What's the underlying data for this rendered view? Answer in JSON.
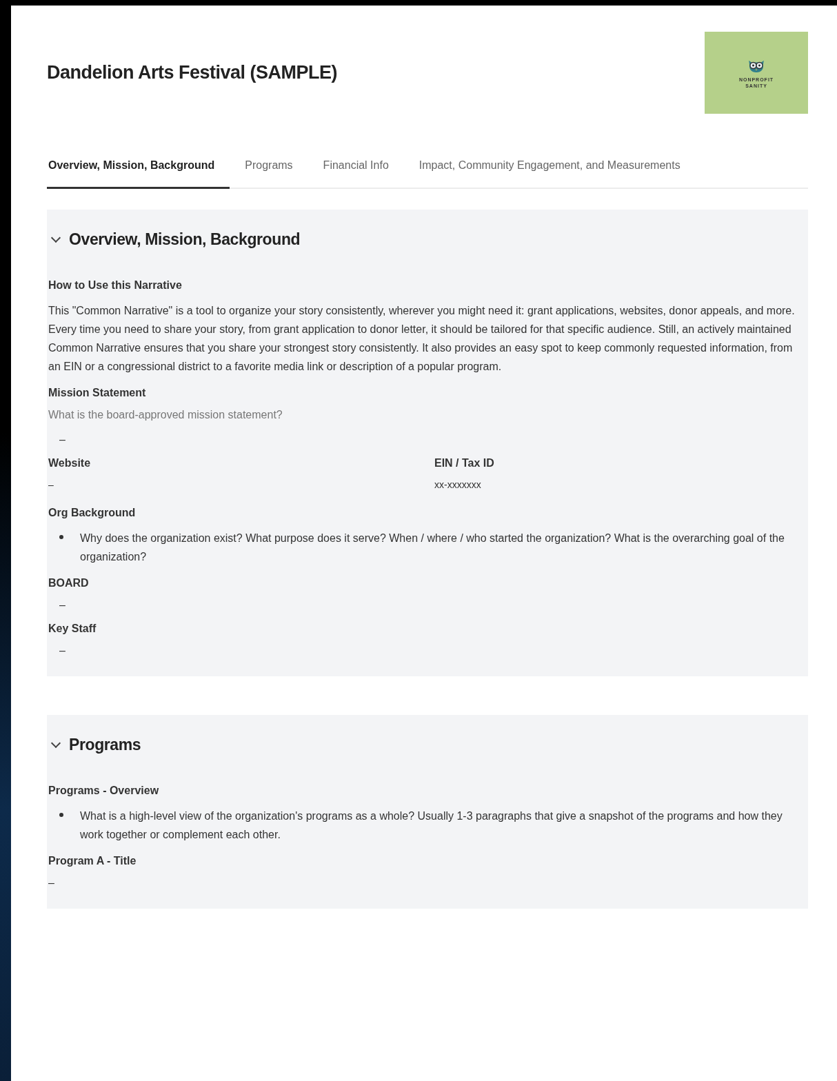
{
  "title": "Dandelion Arts Festival (SAMPLE)",
  "logo": {
    "lines": [
      "NONPROFIT",
      "SANITY"
    ]
  },
  "tabs": [
    {
      "label": "Overview, Mission, Background",
      "selected": true
    },
    {
      "label": "Programs",
      "selected": false
    },
    {
      "label": "Financial Info",
      "selected": false
    },
    {
      "label": "Impact, Community Engagement, and Measurements",
      "selected": false
    }
  ],
  "sections": [
    {
      "heading": "Overview, Mission, Background",
      "expanded": true,
      "fields": [
        {
          "kind": "text",
          "label": "How to Use this Narrative",
          "value": "This \"Common Narrative\" is a tool to organize your story consistently, wherever you might need it: grant applications, websites, donor appeals, and more. Every time you need to share your story, from grant application to donor letter, it should be tailored for that specific audience. Still, an actively maintained Common Narrative ensures that you share your strongest story consistently. It also provides an easy spot to keep commonly requested information, from an EIN or a congressional district to a favorite media link or description of a popular program."
        },
        {
          "kind": "hint",
          "label": "Mission Statement",
          "hint": "What is the board-approved mission statement?",
          "value": "–"
        },
        {
          "kind": "pair",
          "items": [
            {
              "label": "Website",
              "value": "–"
            },
            {
              "label": "EIN / Tax ID",
              "value": "xx-xxxxxxx"
            }
          ]
        },
        {
          "kind": "bullets",
          "label": "Org Background",
          "items": [
            "Why does the organization exist? What purpose does it serve? When / where / who started the organization? What is the overarching goal of the organization?"
          ]
        },
        {
          "kind": "empty",
          "label": "BOARD",
          "value": "–"
        },
        {
          "kind": "empty",
          "label": "Key Staff",
          "value": "–"
        }
      ]
    },
    {
      "heading": "Programs",
      "expanded": true,
      "fields": [
        {
          "kind": "bullets",
          "label": "Programs - Overview",
          "items": [
            "What is a high-level view of the organization's programs as a whole? Usually 1-3 paragraphs that give a snapshot of the programs and how they work together or complement each other."
          ]
        },
        {
          "kind": "plain",
          "label": "Program A - Title",
          "value": "–"
        }
      ]
    }
  ]
}
